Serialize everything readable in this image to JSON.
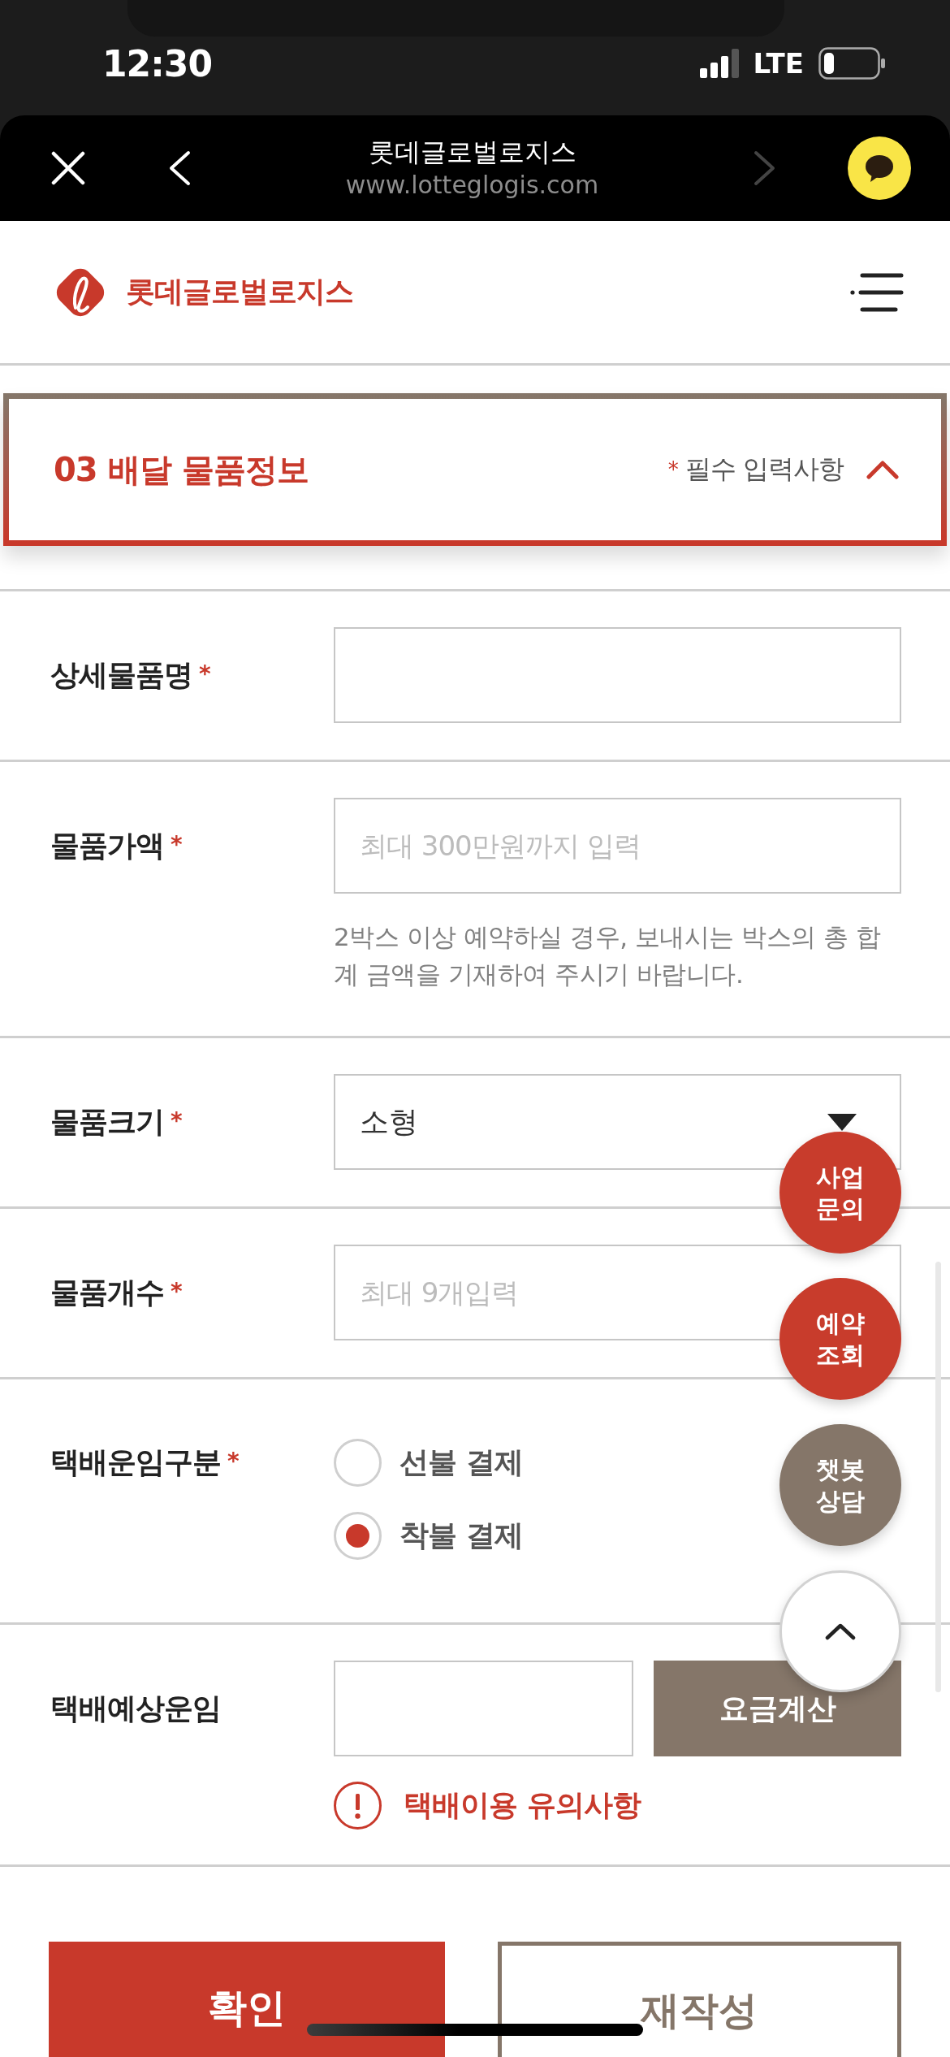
{
  "status_bar": {
    "time": "12:30",
    "network": "LTE"
  },
  "browser_bar": {
    "title": "롯데글로벌로지스",
    "url": "www.lotteglogis.com",
    "back_disabled": false,
    "forward_disabled": true
  },
  "site_header": {
    "logo_text": "롯데글로벌로지스"
  },
  "section": {
    "title": "03 배달 물품정보",
    "required_mark": "*",
    "required_note": "필수 입력사항",
    "expanded": true
  },
  "form_rows": [
    {
      "kind": "text",
      "label": "상세물품명",
      "required_mark": "*"
    },
    {
      "kind": "text",
      "label": "물품가액",
      "required_mark": "*",
      "placeholder": "최대 300만원까지 입력",
      "note": "2박스 이상 예약하실 경우, 보내시는 박스의 총 합계 금액을 기재하여 주시기 바랍니다."
    },
    {
      "kind": "select",
      "label": "물품크기",
      "required_mark": "*",
      "value": "소형"
    },
    {
      "kind": "text",
      "label": "물품개수",
      "required_mark": "*",
      "placeholder": "최대 9개입력"
    },
    {
      "kind": "radio",
      "label": "택배운임구분",
      "required_mark": "*",
      "options": [
        {
          "label": "선불 결제",
          "selected": false
        },
        {
          "label": "착불 결제",
          "selected": true
        }
      ]
    },
    {
      "kind": "fee",
      "label": "택배예상운임",
      "button": "요금계산",
      "notice": "택배이용 유의사항"
    }
  ],
  "buttons": [
    {
      "kind": "primary",
      "label": "확인"
    },
    {
      "kind": "outline",
      "label": "재작성"
    }
  ],
  "floating_buttons": [
    {
      "kind": "label",
      "label": "사업 문의",
      "color": "#c83c2c"
    },
    {
      "kind": "label",
      "label": "예약 조회",
      "color": "#c83c2c"
    },
    {
      "kind": "label",
      "label": "챗봇 상담",
      "color": "#857669"
    },
    {
      "kind": "scroll_top",
      "color": "#ffffff"
    }
  ]
}
